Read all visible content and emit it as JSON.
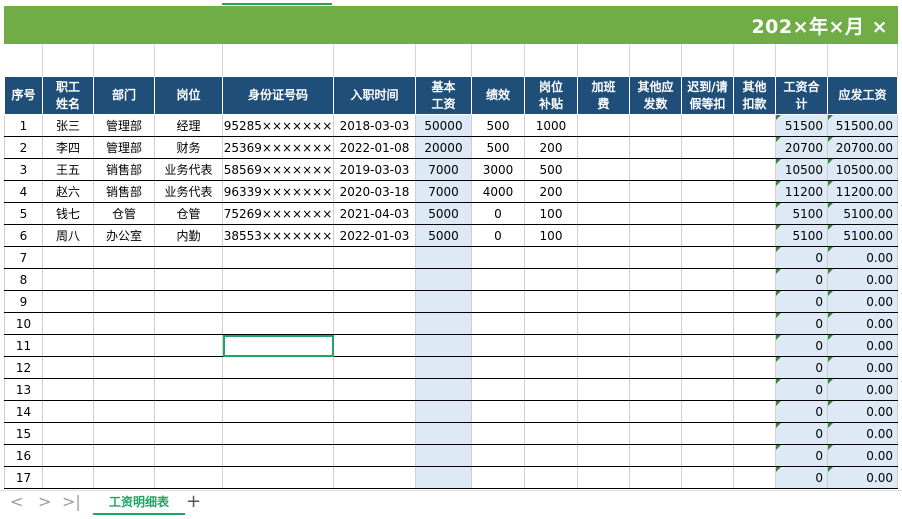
{
  "banner": {
    "title": "202×年×月 ×"
  },
  "headers": [
    "序号",
    "职工\n姓名",
    "部门",
    "岗位",
    "身份证号码",
    "入职时间",
    "基本\n工资",
    "绩效",
    "岗位\n补贴",
    "加班\n费",
    "其他应\n发数",
    "迟到/请\n假等扣",
    "其他\n扣款",
    "工资合\n计",
    "应发工资"
  ],
  "rows": [
    [
      "1",
      "张三",
      "管理部",
      "经理",
      "95285×××××××",
      "2018-03-03",
      "50000",
      "500",
      "1000",
      "",
      "",
      "",
      "",
      "51500",
      "51500.00"
    ],
    [
      "2",
      "李四",
      "管理部",
      "财务",
      "25369×××××××",
      "2022-01-08",
      "20000",
      "500",
      "200",
      "",
      "",
      "",
      "",
      "20700",
      "20700.00"
    ],
    [
      "3",
      "王五",
      "销售部",
      "业务代表",
      "58569×××××××",
      "2019-03-03",
      "7000",
      "3000",
      "500",
      "",
      "",
      "",
      "",
      "10500",
      "10500.00"
    ],
    [
      "4",
      "赵六",
      "销售部",
      "业务代表",
      "96339×××××××",
      "2020-03-18",
      "7000",
      "4000",
      "200",
      "",
      "",
      "",
      "",
      "11200",
      "11200.00"
    ],
    [
      "5",
      "钱七",
      "仓管",
      "仓管",
      "75269×××××××",
      "2021-04-03",
      "5000",
      "0",
      "100",
      "",
      "",
      "",
      "",
      "5100",
      "5100.00"
    ],
    [
      "6",
      "周八",
      "办公室",
      "内勤",
      "38553×××××××",
      "2022-01-03",
      "5000",
      "0",
      "100",
      "",
      "",
      "",
      "",
      "5100",
      "5100.00"
    ],
    [
      "7",
      "",
      "",
      "",
      "",
      "",
      "",
      "",
      "",
      "",
      "",
      "",
      "",
      "0",
      "0.00"
    ],
    [
      "8",
      "",
      "",
      "",
      "",
      "",
      "",
      "",
      "",
      "",
      "",
      "",
      "",
      "0",
      "0.00"
    ],
    [
      "9",
      "",
      "",
      "",
      "",
      "",
      "",
      "",
      "",
      "",
      "",
      "",
      "",
      "0",
      "0.00"
    ],
    [
      "10",
      "",
      "",
      "",
      "",
      "",
      "",
      "",
      "",
      "",
      "",
      "",
      "",
      "0",
      "0.00"
    ],
    [
      "11",
      "",
      "",
      "",
      "",
      "",
      "",
      "",
      "",
      "",
      "",
      "",
      "",
      "0",
      "0.00"
    ],
    [
      "12",
      "",
      "",
      "",
      "",
      "",
      "",
      "",
      "",
      "",
      "",
      "",
      "",
      "0",
      "0.00"
    ],
    [
      "13",
      "",
      "",
      "",
      "",
      "",
      "",
      "",
      "",
      "",
      "",
      "",
      "",
      "0",
      "0.00"
    ],
    [
      "14",
      "",
      "",
      "",
      "",
      "",
      "",
      "",
      "",
      "",
      "",
      "",
      "",
      "0",
      "0.00"
    ],
    [
      "15",
      "",
      "",
      "",
      "",
      "",
      "",
      "",
      "",
      "",
      "",
      "",
      "",
      "0",
      "0.00"
    ],
    [
      "16",
      "",
      "",
      "",
      "",
      "",
      "",
      "",
      "",
      "",
      "",
      "",
      "",
      "0",
      "0.00"
    ],
    [
      "17",
      "",
      "",
      "",
      "",
      "",
      "",
      "",
      "",
      "",
      "",
      "",
      "",
      "0",
      "0.00"
    ]
  ],
  "active_cell": {
    "row": 10,
    "col": 4
  },
  "sheet_tab": "工资明细表",
  "nav": {
    "prev": "<",
    "next": ">",
    "last": ">|",
    "add": "+"
  },
  "colors": {
    "banner": "#70ad47",
    "header": "#1f4e79",
    "highlight": "#dde9f5",
    "accent": "#21a366"
  }
}
